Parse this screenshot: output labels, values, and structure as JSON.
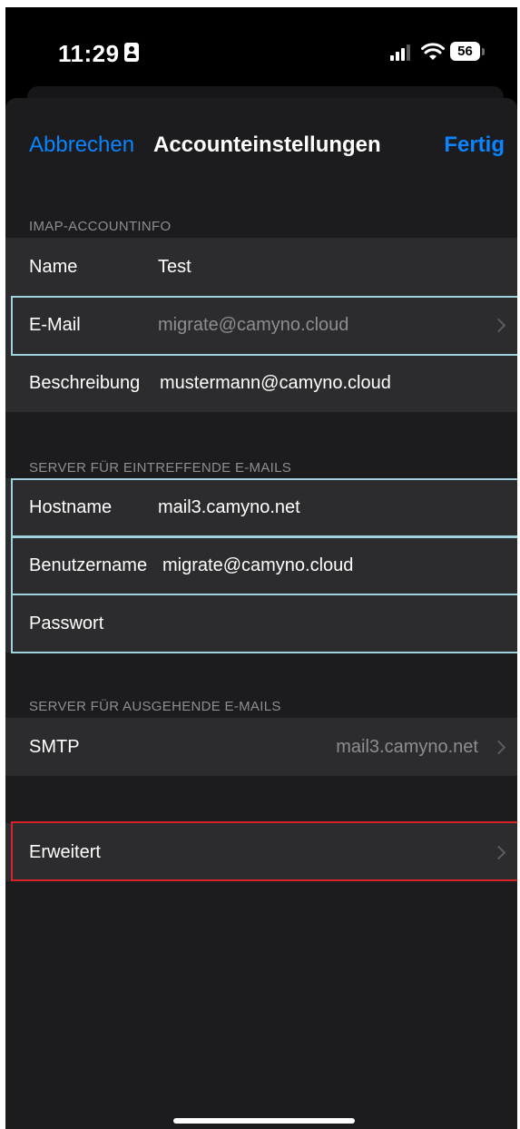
{
  "status_bar": {
    "time": "11:29",
    "battery": "56",
    "icons": [
      "contact-card-icon",
      "cellular-signal-icon",
      "wifi-icon",
      "battery-icon"
    ]
  },
  "nav": {
    "cancel_label": "Abbrechen",
    "title": "Accounteinstellungen",
    "done_label": "Fertig"
  },
  "sections": {
    "imap": {
      "header": "IMAP-ACCOUNTINFO",
      "name": {
        "label": "Name",
        "value": "Test"
      },
      "email": {
        "label": "E-Mail",
        "value": "migrate@camyno.cloud"
      },
      "description": {
        "label": "Beschreibung",
        "value": "mustermann@camyno.cloud"
      }
    },
    "incoming": {
      "header": "SERVER FÜR EINTREFFENDE E-MAILS",
      "hostname": {
        "label": "Hostname",
        "value": "mail3.camyno.net"
      },
      "username": {
        "label": "Benutzername",
        "value": "migrate@camyno.cloud"
      },
      "password": {
        "label": "Passwort",
        "value": ""
      }
    },
    "outgoing": {
      "header": "SERVER FÜR AUSGEHENDE E-MAILS",
      "smtp": {
        "label": "SMTP",
        "value": "mail3.camyno.net"
      }
    },
    "advanced": {
      "label": "Erweitert"
    }
  },
  "colors": {
    "accent": "#0a84ff",
    "background": "#1c1c1e",
    "cell": "#2c2c2e",
    "highlight_blue": "#9fd3e0",
    "highlight_red": "#d8222a"
  }
}
